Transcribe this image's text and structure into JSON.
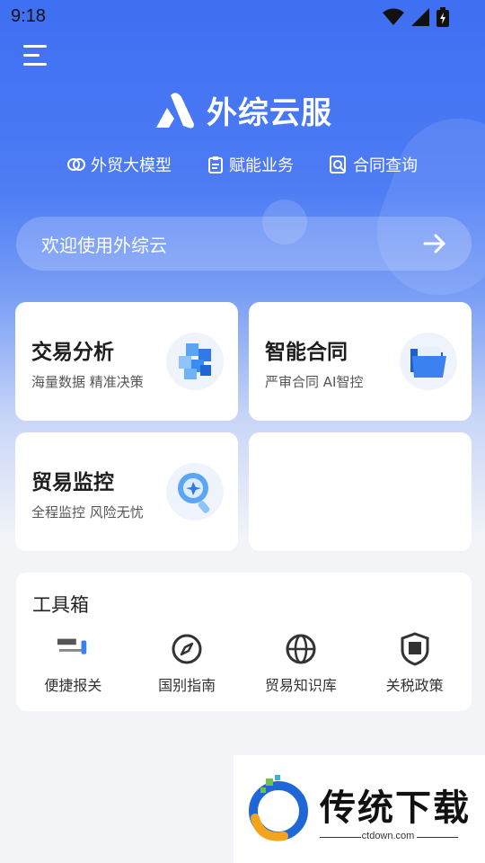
{
  "status_bar": {
    "time": "9:18"
  },
  "brand": {
    "title": "外综云服"
  },
  "quick_links": [
    {
      "label": "外贸大模型",
      "icon": "brain-icon"
    },
    {
      "label": "赋能业务",
      "icon": "clipboard-icon"
    },
    {
      "label": "合同查询",
      "icon": "doc-search-icon"
    }
  ],
  "search": {
    "text": "欢迎使用外综云"
  },
  "cards": [
    {
      "title": "交易分析",
      "subtitle": "海量数据 精准决策",
      "icon": "cubes-icon"
    },
    {
      "title": "智能合同",
      "subtitle": "严审合同 AI智控",
      "icon": "folder-icon"
    },
    {
      "title": "贸易监控",
      "subtitle": "全程监控 风险无忧",
      "icon": "magnifier-icon"
    }
  ],
  "toolbox": {
    "title": "工具箱",
    "items": [
      {
        "label": "便捷报关",
        "icon": "customs-doc-icon"
      },
      {
        "label": "国别指南",
        "icon": "compass-icon"
      },
      {
        "label": "贸易知识库",
        "icon": "globe-icon"
      },
      {
        "label": "关税政策",
        "icon": "tax-shield-icon"
      }
    ]
  },
  "watermark": {
    "title": "传统下载",
    "url": "ctdown.com"
  },
  "colors": {
    "brand_blue": "#3f6ff2",
    "card_bg": "#ffffff",
    "page_bg": "#f2f4f8"
  }
}
